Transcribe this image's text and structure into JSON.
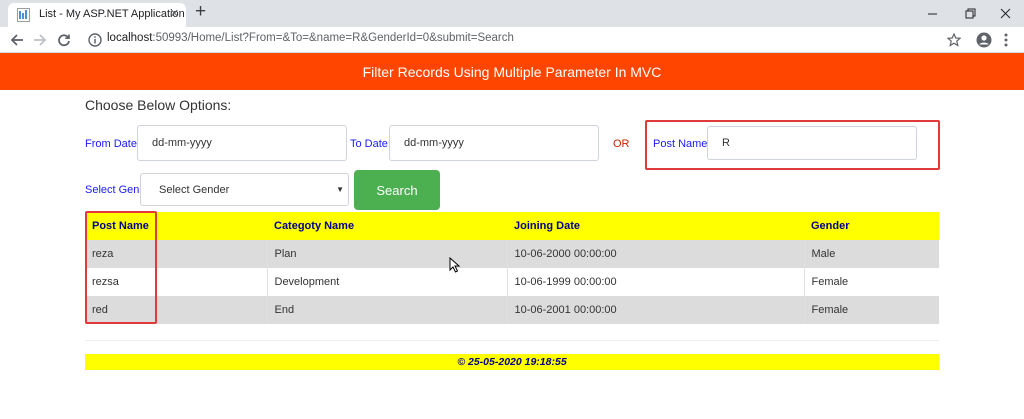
{
  "browser": {
    "tab_title": "List - My ASP.NET Application",
    "url_host": "localhost",
    "url_rest": ":50993/Home/List?From=&To=&name=R&GenderId=0&submit=Search"
  },
  "header": {
    "title": "Filter Records Using Multiple Parameter In MVC"
  },
  "filters": {
    "heading": "Choose Below Options:",
    "from_label": "From Date:",
    "from_value": "dd-mm-yyyy",
    "to_label": "To Date:",
    "to_value": "dd-mm-yyyy",
    "or_text": "OR",
    "post_label": "Post Name:",
    "post_value": "R",
    "gender_label": "Select Gen:",
    "gender_selected": "Select Gender",
    "search_label": "Search"
  },
  "table": {
    "columns": [
      "Post Name",
      "Categoty Name",
      "Joining Date",
      "Gender"
    ],
    "rows": [
      [
        "reza",
        "Plan",
        "10-06-2000 00:00:00",
        "Male"
      ],
      [
        "rezsa",
        "Development",
        "10-06-1999 00:00:00",
        "Female"
      ],
      [
        "red",
        "End",
        "10-06-2001 00:00:00",
        "Female"
      ]
    ]
  },
  "footer": {
    "text": "© 25-05-2020 19:18:55"
  },
  "colors": {
    "header_bg": "#ff4500",
    "table_header_bg": "#ffff00",
    "button_bg": "#4caf50",
    "highlight": "#e03a3a"
  }
}
